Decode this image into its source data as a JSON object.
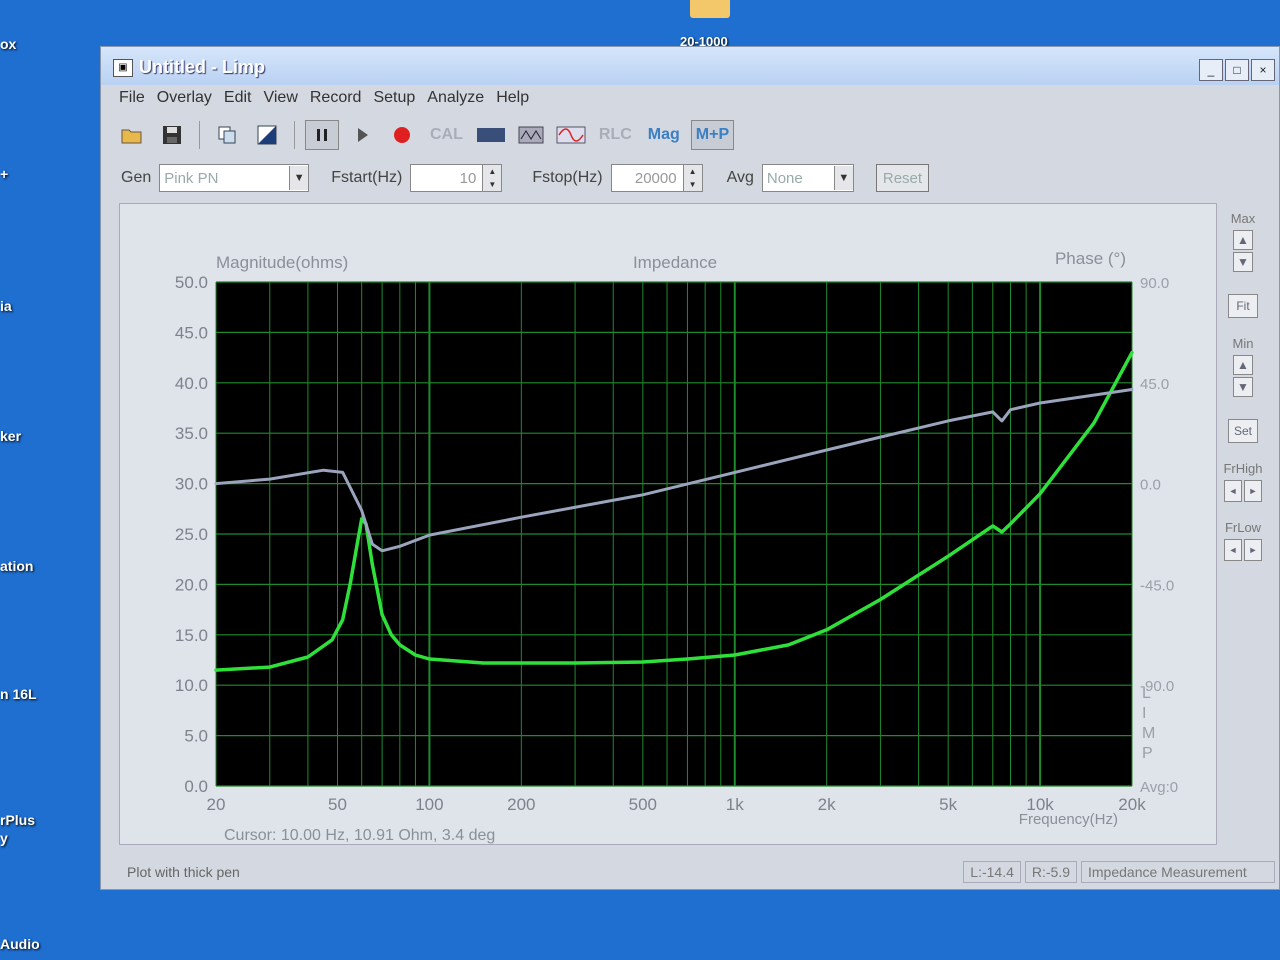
{
  "desktop": {
    "icon_labels": [
      "ox",
      "+",
      "ia",
      "ker",
      "ation",
      "n 16L",
      "rPlus",
      "y",
      "Audio"
    ],
    "folder_label": "20-1000"
  },
  "window": {
    "title": "Untitled - Limp",
    "controls": [
      "_",
      "□",
      "×"
    ]
  },
  "menu": [
    "File",
    "Overlay",
    "Edit",
    "View",
    "Record",
    "Setup",
    "Analyze",
    "Help"
  ],
  "toolbar": {
    "cal": "CAL",
    "rlc": "RLC",
    "mag": "Mag",
    "mp": "M+P"
  },
  "params": {
    "gen_label": "Gen",
    "gen_value": "Pink PN",
    "fstart_label": "Fstart(Hz)",
    "fstart_value": "10",
    "fstop_label": "Fstop(Hz)",
    "fstop_value": "20000",
    "avg_label": "Avg",
    "avg_value": "None",
    "reset": "Reset"
  },
  "right_panel": {
    "max": "Max",
    "fit": "Fit",
    "min": "Min",
    "set": "Set",
    "frhigh": "FrHigh",
    "frlow": "FrLow"
  },
  "status": {
    "left": "Plot with thick pen",
    "l": "L:-14.4",
    "r": "R:-5.9",
    "mode": "Impedance Measurement"
  },
  "colors": {
    "magnitude": "#2fe03a",
    "phase": "#9aa4bc",
    "grid": "#1f8a2a",
    "plot_bg": "#000000"
  },
  "chart_data": {
    "type": "line",
    "title": "Impedance",
    "ylabel": "Magnitude(ohms)",
    "y2label": "Phase (°)",
    "xlabel": "Frequency(Hz)",
    "x_scale": "log",
    "xlim": [
      20,
      20000
    ],
    "ylim": [
      0,
      50
    ],
    "y2lim": [
      -135,
      90
    ],
    "y_ticks": [
      "0.0",
      "5.0",
      "10.0",
      "15.0",
      "20.0",
      "25.0",
      "30.0",
      "35.0",
      "40.0",
      "45.0",
      "50.0"
    ],
    "y2_ticks": [
      "90.0",
      "45.0",
      "0.0",
      "-45.0",
      "-90.0"
    ],
    "y2_extra": "Avg:0",
    "x_ticks": [
      {
        "v": 20,
        "label": "20"
      },
      {
        "v": 50,
        "label": "50"
      },
      {
        "v": 100,
        "label": "100"
      },
      {
        "v": 200,
        "label": "200"
      },
      {
        "v": 500,
        "label": "500"
      },
      {
        "v": 1000,
        "label": "1k"
      },
      {
        "v": 2000,
        "label": "2k"
      },
      {
        "v": 5000,
        "label": "5k"
      },
      {
        "v": 10000,
        "label": "10k"
      },
      {
        "v": 20000,
        "label": "20k"
      }
    ],
    "side_label": "LIMP",
    "cursor": "Cursor: 10.00 Hz, 10.91 Ohm, 3.4 deg",
    "series": [
      {
        "name": "Magnitude",
        "axis": "left",
        "points": [
          [
            20,
            11.5
          ],
          [
            30,
            11.8
          ],
          [
            40,
            12.8
          ],
          [
            48,
            14.5
          ],
          [
            52,
            16.5
          ],
          [
            55,
            20
          ],
          [
            58,
            24
          ],
          [
            60,
            26.5
          ],
          [
            62,
            26
          ],
          [
            65,
            22
          ],
          [
            70,
            17
          ],
          [
            75,
            15
          ],
          [
            80,
            14
          ],
          [
            90,
            13
          ],
          [
            100,
            12.6
          ],
          [
            150,
            12.2
          ],
          [
            200,
            12.2
          ],
          [
            300,
            12.2
          ],
          [
            500,
            12.3
          ],
          [
            700,
            12.6
          ],
          [
            1000,
            13.0
          ],
          [
            1500,
            14.0
          ],
          [
            2000,
            15.5
          ],
          [
            3000,
            18.5
          ],
          [
            5000,
            22.8
          ],
          [
            7000,
            25.8
          ],
          [
            7500,
            25.2
          ],
          [
            8000,
            26.0
          ],
          [
            10000,
            29
          ],
          [
            15000,
            36
          ],
          [
            20000,
            43
          ]
        ]
      },
      {
        "name": "Phase",
        "axis": "right",
        "points": [
          [
            20,
            0
          ],
          [
            30,
            2
          ],
          [
            45,
            6
          ],
          [
            52,
            5
          ],
          [
            60,
            -12
          ],
          [
            65,
            -27
          ],
          [
            70,
            -30
          ],
          [
            80,
            -28
          ],
          [
            100,
            -23
          ],
          [
            200,
            -15
          ],
          [
            500,
            -5
          ],
          [
            1000,
            5
          ],
          [
            2000,
            15
          ],
          [
            5000,
            28
          ],
          [
            7000,
            32
          ],
          [
            7500,
            28
          ],
          [
            8000,
            33
          ],
          [
            10000,
            36
          ],
          [
            20000,
            42
          ]
        ]
      }
    ]
  }
}
